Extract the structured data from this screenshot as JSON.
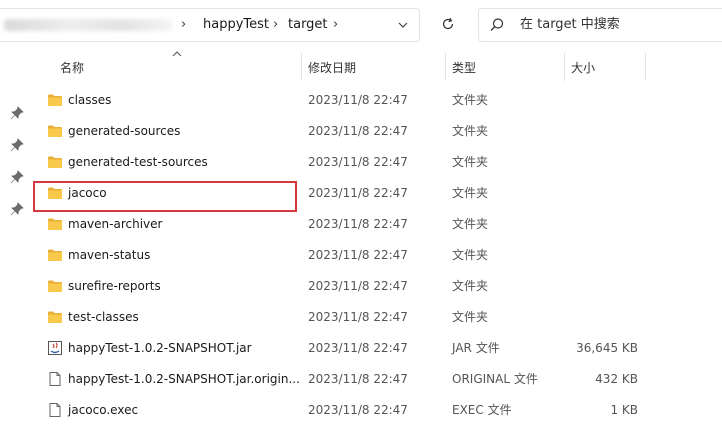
{
  "address": {
    "crumbs": [
      "happyTest",
      "target"
    ]
  },
  "search": {
    "placeholder": "在 target 中搜索"
  },
  "columns": {
    "name": "名称",
    "date": "修改日期",
    "type": "类型",
    "size": "大小"
  },
  "files": [
    {
      "name": "classes",
      "date": "2023/11/8 22:47",
      "type": "文件夹",
      "size": "",
      "icon": "folder-icon"
    },
    {
      "name": "generated-sources",
      "date": "2023/11/8 22:47",
      "type": "文件夹",
      "size": "",
      "icon": "folder-icon"
    },
    {
      "name": "generated-test-sources",
      "date": "2023/11/8 22:47",
      "type": "文件夹",
      "size": "",
      "icon": "folder-icon"
    },
    {
      "name": "jacoco",
      "date": "2023/11/8 22:47",
      "type": "文件夹",
      "size": "",
      "icon": "folder-icon",
      "highlighted": true
    },
    {
      "name": "maven-archiver",
      "date": "2023/11/8 22:47",
      "type": "文件夹",
      "size": "",
      "icon": "folder-icon"
    },
    {
      "name": "maven-status",
      "date": "2023/11/8 22:47",
      "type": "文件夹",
      "size": "",
      "icon": "folder-icon"
    },
    {
      "name": "surefire-reports",
      "date": "2023/11/8 22:47",
      "type": "文件夹",
      "size": "",
      "icon": "folder-icon"
    },
    {
      "name": "test-classes",
      "date": "2023/11/8 22:47",
      "type": "文件夹",
      "size": "",
      "icon": "folder-icon"
    },
    {
      "name": "happyTest-1.0.2-SNAPSHOT.jar",
      "date": "2023/11/8 22:47",
      "type": "JAR 文件",
      "size": "36,645 KB",
      "icon": "jar-file-icon"
    },
    {
      "name": "happyTest-1.0.2-SNAPSHOT.jar.origin...",
      "date": "2023/11/8 22:47",
      "type": "ORIGINAL 文件",
      "size": "432 KB",
      "icon": "file-icon"
    },
    {
      "name": "jacoco.exec",
      "date": "2023/11/8 22:47",
      "type": "EXEC 文件",
      "size": "1 KB",
      "icon": "file-icon"
    }
  ],
  "colors": {
    "highlight": "#d9373e",
    "folder": "#f8c94a"
  }
}
